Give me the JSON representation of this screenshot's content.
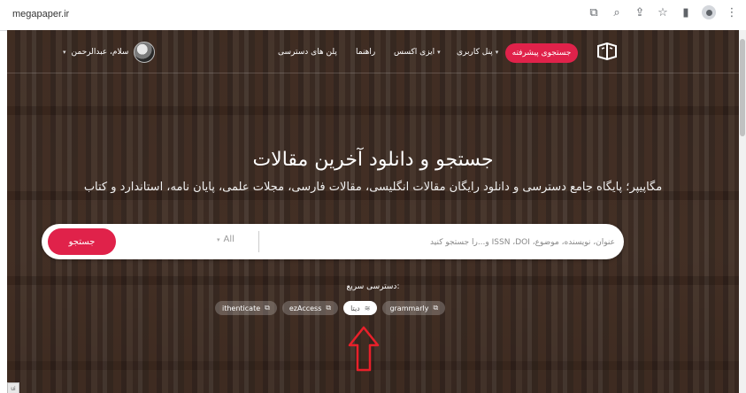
{
  "browser": {
    "url": "megapaper.ir",
    "icons": [
      "translate-icon",
      "zoom-icon",
      "share-icon",
      "star-icon",
      "sidepanel-icon",
      "profile-icon",
      "kebab-icon"
    ]
  },
  "nav": {
    "advanced_search": "جستجوی پیشرفته",
    "user_panel": "پنل کاربری",
    "easy_access": "ایزی اکسس",
    "guide": "راهنما",
    "access_plans": "پلن های دسترسی",
    "greeting": "سلام، عبدالرحمن"
  },
  "hero": {
    "title": "جستجو و دانلود آخرین مقالات",
    "subtitle": "مگاپیپر؛ پایگاه جامع دسترسی و دانلود رایگان مقالات انگلیسی، مقالات فارسی، مجلات علمی، پایان نامه، استاندارد و کتاب"
  },
  "search": {
    "button": "جستجو",
    "filter": "All",
    "placeholder": "عنوان، نویسنده، موضوع، ISSN ،DOI و...را جستجو کنید"
  },
  "quick_access": {
    "label": "دسترسی سریع:",
    "chips": [
      "ithenticate",
      "ezAccess",
      "دیتا",
      "grammarly"
    ]
  },
  "colors": {
    "accent": "#e0224a"
  }
}
